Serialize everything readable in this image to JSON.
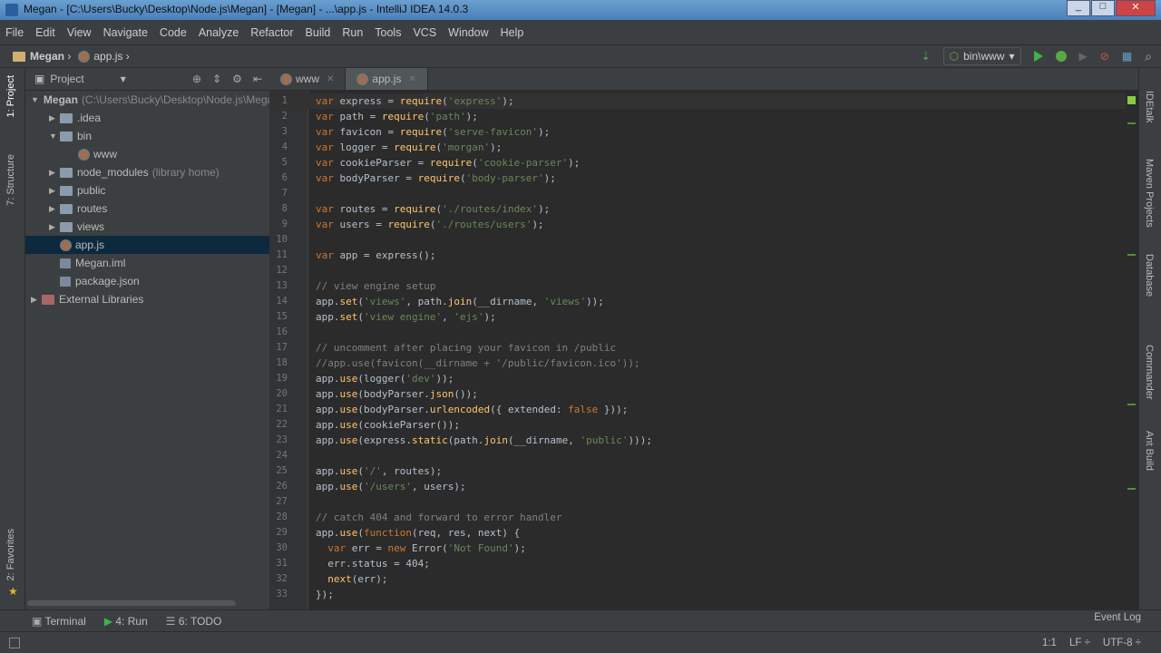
{
  "window": {
    "title": "Megan - [C:\\Users\\Bucky\\Desktop\\Node.js\\Megan] - [Megan] - ...\\app.js - IntelliJ IDEA 14.0.3"
  },
  "menu": [
    "File",
    "Edit",
    "View",
    "Navigate",
    "Code",
    "Analyze",
    "Refactor",
    "Build",
    "Run",
    "Tools",
    "VCS",
    "Window",
    "Help"
  ],
  "breadcrumb": {
    "project": "Megan",
    "file": "app.js"
  },
  "run_config": "bin\\www",
  "left_tabs": {
    "project": "1: Project",
    "structure": "7: Structure",
    "favorites": "2: Favorites"
  },
  "right_tabs": [
    "IDEtalk",
    "Maven Projects",
    "Database",
    "Commander",
    "Ant Build"
  ],
  "project_panel": {
    "title": "Project",
    "tree": [
      {
        "label": "Megan",
        "extra": "(C:\\Users\\Bucky\\Desktop\\Node.js\\Megan)",
        "level": 0,
        "arrow": "▼",
        "icon": "folder"
      },
      {
        "label": ".idea",
        "level": 1,
        "arrow": "▶",
        "icon": "folder"
      },
      {
        "label": "bin",
        "level": 1,
        "arrow": "▼",
        "icon": "folder"
      },
      {
        "label": "www",
        "level": 2,
        "arrow": "",
        "icon": "js"
      },
      {
        "label": "node_modules",
        "extra": "(library home)",
        "level": 1,
        "arrow": "▶",
        "icon": "folder"
      },
      {
        "label": "public",
        "level": 1,
        "arrow": "▶",
        "icon": "folder"
      },
      {
        "label": "routes",
        "level": 1,
        "arrow": "▶",
        "icon": "folder"
      },
      {
        "label": "views",
        "level": 1,
        "arrow": "▶",
        "icon": "folder"
      },
      {
        "label": "app.js",
        "level": 1,
        "arrow": "",
        "icon": "js",
        "selected": true
      },
      {
        "label": "Megan.iml",
        "level": 1,
        "arrow": "",
        "icon": "file"
      },
      {
        "label": "package.json",
        "level": 1,
        "arrow": "",
        "icon": "file"
      },
      {
        "label": "External Libraries",
        "level": 0,
        "arrow": "▶",
        "icon": "lib"
      }
    ]
  },
  "editor_tabs": [
    {
      "label": "www",
      "active": false
    },
    {
      "label": "app.js",
      "active": true
    }
  ],
  "code": [
    "var express = require('express');",
    "var path = require('path');",
    "var favicon = require('serve-favicon');",
    "var logger = require('morgan');",
    "var cookieParser = require('cookie-parser');",
    "var bodyParser = require('body-parser');",
    "",
    "var routes = require('./routes/index');",
    "var users = require('./routes/users');",
    "",
    "var app = express();",
    "",
    "// view engine setup",
    "app.set('views', path.join(__dirname, 'views'));",
    "app.set('view engine', 'ejs');",
    "",
    "// uncomment after placing your favicon in /public",
    "//app.use(favicon(__dirname + '/public/favicon.ico'));",
    "app.use(logger('dev'));",
    "app.use(bodyParser.json());",
    "app.use(bodyParser.urlencoded({ extended: false }));",
    "app.use(cookieParser());",
    "app.use(express.static(path.join(__dirname, 'public')));",
    "",
    "app.use('/', routes);",
    "app.use('/users', users);",
    "",
    "// catch 404 and forward to error handler",
    "app.use(function(req, res, next) {",
    "  var err = new Error('Not Found');",
    "  err.status = 404;",
    "  next(err);",
    "});"
  ],
  "bottom_tools": [
    {
      "label": "Terminal"
    },
    {
      "label": "4: Run"
    },
    {
      "label": "6: TODO"
    }
  ],
  "status": {
    "event_log": "Event Log",
    "position": "1:1",
    "line_sep": "LF ÷",
    "encoding": "UTF-8 ÷"
  }
}
